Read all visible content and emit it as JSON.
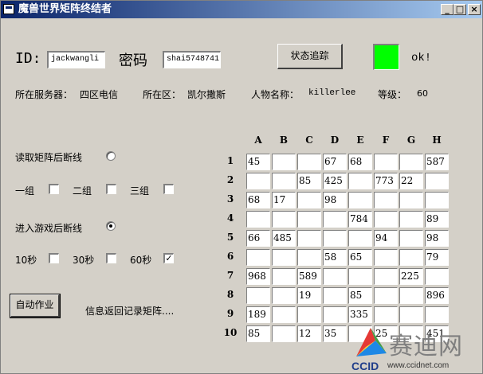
{
  "window": {
    "title": "魔兽世界矩阵终结者",
    "min_glyph": "_",
    "max_glyph": "□",
    "close_glyph": "×"
  },
  "login": {
    "id_label": "ID:",
    "id_value": "jackwangli",
    "password_label": "密码",
    "password_value": "shai5748741",
    "track_button": "状态追踪",
    "status_color": "#00ff00",
    "status_text": "ok!"
  },
  "info": {
    "server_label": "所在服务器：",
    "server_value": "四区电信",
    "zone_label": "所在区：",
    "zone_value": "凯尔撒斯",
    "char_label": "人物名称：",
    "char_value": "killerlee",
    "level_label": "等级：",
    "level_value": "60"
  },
  "options": {
    "read_disconnect": "读取矩阵后断线",
    "group1": "一组",
    "group2": "二组",
    "group3": "三组",
    "enter_disconnect": "进入游戏后断线",
    "t10": "10秒",
    "t30": "30秒",
    "t60": "60秒",
    "read_selected": false,
    "enter_selected": true,
    "t60_checked": true,
    "check_glyph": "✓"
  },
  "actions": {
    "auto_button": "自动作业",
    "status_message": "信息返回记录矩阵...."
  },
  "matrix": {
    "columns": [
      "A",
      "B",
      "C",
      "D",
      "E",
      "F",
      "G",
      "H"
    ],
    "rows": [
      "1",
      "2",
      "3",
      "4",
      "5",
      "6",
      "7",
      "8",
      "9",
      "10"
    ],
    "values": [
      [
        "45",
        "",
        "",
        "67",
        "68",
        "",
        "",
        "587"
      ],
      [
        "",
        "",
        "85",
        "425",
        "",
        "773",
        "22",
        ""
      ],
      [
        "68",
        "17",
        "",
        "98",
        "",
        "",
        "",
        ""
      ],
      [
        "",
        "",
        "",
        "",
        "784",
        "",
        "",
        "89"
      ],
      [
        "66",
        "485",
        "",
        "",
        "",
        "94",
        "",
        "98"
      ],
      [
        "",
        "",
        "",
        "58",
        "65",
        "",
        "",
        "79"
      ],
      [
        "968",
        "",
        "589",
        "",
        "",
        "",
        "225",
        ""
      ],
      [
        "",
        "",
        "19",
        "",
        "85",
        "",
        "",
        "896"
      ],
      [
        "189",
        "",
        "",
        "",
        "335",
        "",
        "",
        ""
      ],
      [
        "85",
        "",
        "12",
        "35",
        "",
        "25",
        "",
        "451"
      ]
    ]
  },
  "watermark": {
    "brand": "赛迪网",
    "ccid": "CCID",
    "url": "www.ccidnet.com"
  }
}
